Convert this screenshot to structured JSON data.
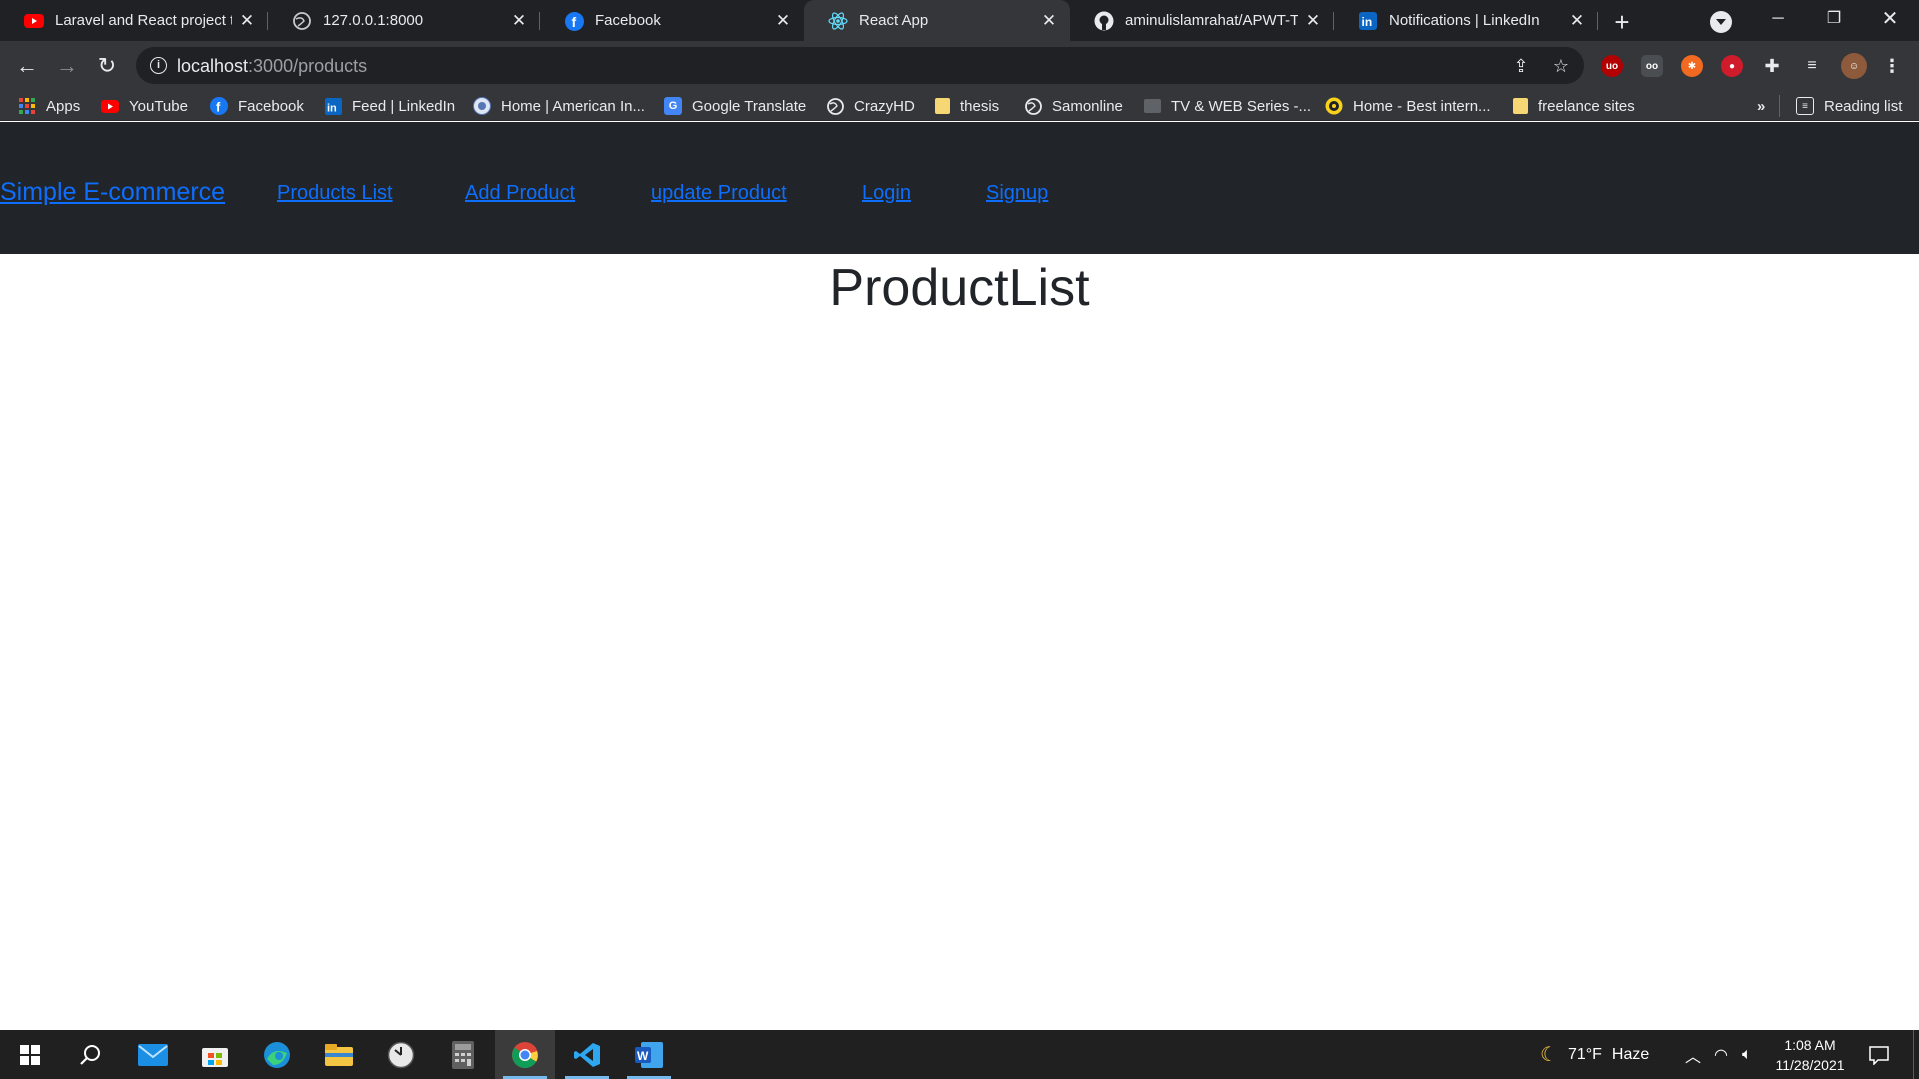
{
  "tabs": [
    {
      "title": "Laravel and React project tu",
      "icon": "youtube-icon"
    },
    {
      "title": "127.0.0.1:8000",
      "icon": "globe-icon"
    },
    {
      "title": "Facebook",
      "icon": "facebook-icon"
    },
    {
      "title": "React App",
      "icon": "react-icon"
    },
    {
      "title": "aminulislamrahat/APWT-TA",
      "icon": "github-icon"
    },
    {
      "title": "Notifications | LinkedIn",
      "icon": "linkedin-icon"
    }
  ],
  "address_bar": {
    "host": "localhost",
    "path": ":3000/products"
  },
  "bookmarks": [
    {
      "label": "Apps",
      "icon": "apps-grid-icon"
    },
    {
      "label": "YouTube",
      "icon": "youtube-icon"
    },
    {
      "label": "Facebook",
      "icon": "facebook-icon"
    },
    {
      "label": "Feed | LinkedIn",
      "icon": "linkedin-icon"
    },
    {
      "label": "Home | American In...",
      "icon": "university-icon"
    },
    {
      "label": "Google Translate",
      "icon": "google-translate-icon"
    },
    {
      "label": "CrazyHD",
      "icon": "globe-icon"
    },
    {
      "label": "thesis",
      "icon": "folder-icon"
    },
    {
      "label": "Samonline",
      "icon": "globe-icon"
    },
    {
      "label": "TV & WEB Series -...",
      "icon": "folder-icon"
    },
    {
      "label": "Home - Best intern...",
      "icon": "site-icon"
    },
    {
      "label": "freelance sites",
      "icon": "folder-icon"
    }
  ],
  "bookmarks_overflow": "»",
  "reading_list": "Reading list",
  "navbar": {
    "brand": "Simple E-commerce",
    "links": [
      "Products List",
      "Add Product",
      "update Product",
      "Login",
      "Signup"
    ]
  },
  "page": {
    "title": "ProductList"
  },
  "taskbar": {
    "weather_temp": "71°F",
    "weather_desc": "Haze",
    "time": "1:08 AM",
    "date": "11/28/2021"
  },
  "colors": {
    "link": "#0d6efd",
    "navbar_bg": "#212529",
    "tab_strip": "#202124",
    "toolbar": "#35363a"
  }
}
